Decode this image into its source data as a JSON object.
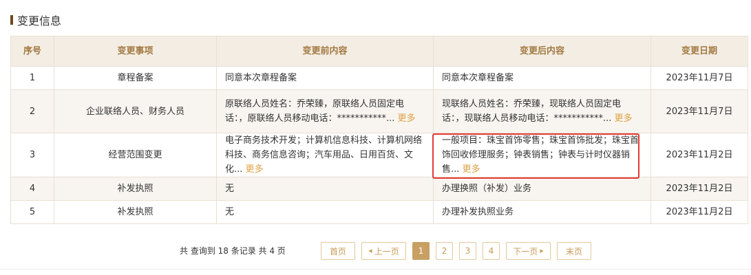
{
  "section": {
    "title": "变更信息"
  },
  "table": {
    "headers": [
      "序号",
      "变更事项",
      "变更前内容",
      "变更后内容",
      "变更日期"
    ],
    "rows": [
      {
        "no": "1",
        "item": "章程备案",
        "before": "同意本次章程备案",
        "before_more": "",
        "after": "同意本次章程备案",
        "after_more": "",
        "date": "2023年11月7日"
      },
      {
        "no": "2",
        "item": "企业联络人员、财务人员",
        "before": "原联络人员姓名：乔荣臻，原联络人员固定电话：，原联络人员移动电话：***********... ",
        "before_more": "更多",
        "after": "现联络人员姓名：乔荣臻，现联络人员固定电话：，现联络人员移动电话：***********... ",
        "after_more": "更多",
        "date": "2023年11月7日"
      },
      {
        "no": "3",
        "item": "经营范围变更",
        "before": "电子商务技术开发；计算机信息科技、计算机网络科技、商务信息咨询；汽车用品、日用百货、文化... ",
        "before_more": "更多",
        "after": "一般项目：珠宝首饰零售；珠宝首饰批发；珠宝首饰回收修理服务；钟表销售；钟表与计时仪器销售... ",
        "after_more": "更多",
        "date": "2023年11月2日"
      },
      {
        "no": "4",
        "item": "补发执照",
        "before": "无",
        "before_more": "",
        "after": "办理换照（补发）业务",
        "after_more": "",
        "date": "2023年11月2日"
      },
      {
        "no": "5",
        "item": "补发执照",
        "before": "无",
        "before_more": "",
        "after": "办理补发执照业务",
        "after_more": "",
        "date": "2023年11月2日"
      }
    ]
  },
  "pagination": {
    "summary": "共 查询到 18 条记录 共 4 页",
    "first": "首页",
    "prev": "上一页",
    "pages": [
      "1",
      "2",
      "3",
      "4"
    ],
    "current_page": "1",
    "next": "下一页",
    "last": "末页"
  },
  "colors": {
    "accent": "#c8a063",
    "header_bg": "#f3ede4",
    "link": "#e0a044",
    "highlight": "#e53935"
  }
}
